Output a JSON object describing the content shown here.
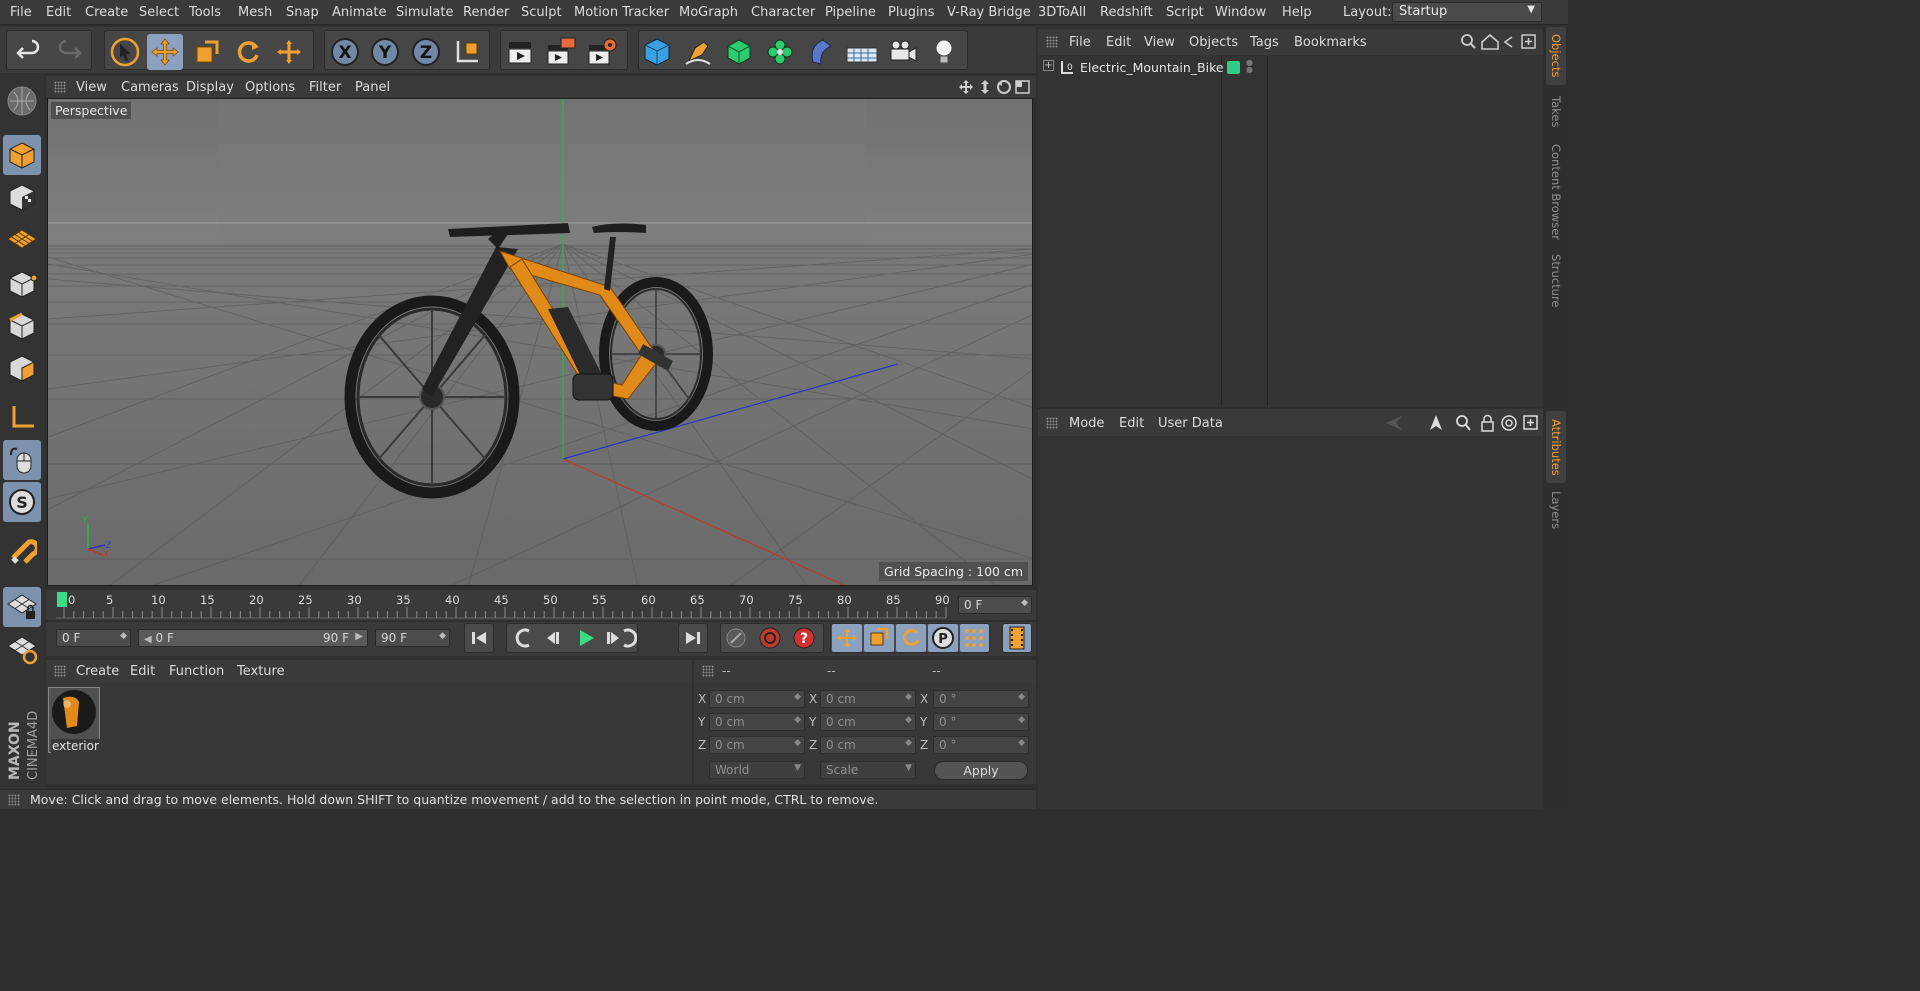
{
  "menubar": {
    "items": [
      "File",
      "Edit",
      "Create",
      "Select",
      "Tools",
      "Mesh",
      "Snap",
      "Animate",
      "Simulate",
      "Render",
      "Sculpt",
      "Motion Tracker",
      "MoGraph",
      "Character",
      "Pipeline",
      "Plugins",
      "V-Ray Bridge",
      "3DToAll",
      "Redshift",
      "Script",
      "Window",
      "Help"
    ],
    "layout_label": "Layout:",
    "layout_value": "Startup"
  },
  "viewport": {
    "menu": [
      "View",
      "Cameras",
      "Display",
      "Options",
      "Filter",
      "Panel"
    ],
    "camera_label": "Perspective",
    "grid_spacing": "Grid Spacing : 100 cm",
    "axis_labels": {
      "y": "Y",
      "x": "X",
      "z": "Z"
    }
  },
  "timeline": {
    "ticks": [
      "0",
      "5",
      "10",
      "15",
      "20",
      "25",
      "30",
      "35",
      "40",
      "45",
      "50",
      "55",
      "60",
      "65",
      "70",
      "75",
      "80",
      "85",
      "90"
    ],
    "current_frame": "0 F",
    "start_field": "0 F",
    "range_start": "0 F",
    "range_end": "90 F",
    "end_field": "90 F"
  },
  "material_manager": {
    "menu": [
      "Create",
      "Edit",
      "Function",
      "Texture"
    ],
    "materials": [
      {
        "name": "exterior"
      }
    ]
  },
  "coordinates": {
    "headers": [
      "--",
      "--",
      "--"
    ],
    "rows": [
      {
        "axis": "X",
        "pos": "0 cm",
        "size": "0 cm",
        "rot_axis": "X",
        "rot": "0 °"
      },
      {
        "axis": "Y",
        "pos": "0 cm",
        "size": "0 cm",
        "rot_axis": "Y",
        "rot": "0 °"
      },
      {
        "axis": "Z",
        "pos": "0 cm",
        "size": "0 cm",
        "rot_axis": "Z",
        "rot": "0 °"
      }
    ],
    "world_select": "World",
    "scale_select": "Scale",
    "apply_label": "Apply"
  },
  "status": {
    "text": "Move: Click and drag to move elements. Hold down SHIFT to quantize movement / add to the selection in point mode, CTRL to remove."
  },
  "logo": {
    "brand": "MAXON",
    "product": "CINEMA4D"
  },
  "objects_panel": {
    "menu": [
      "File",
      "Edit",
      "View",
      "Objects",
      "Tags",
      "Bookmarks"
    ],
    "objects": [
      {
        "name": "Electric_Mountain_Bike",
        "layer_color": "#2ecc8a"
      }
    ]
  },
  "attributes_panel": {
    "menu": [
      "Mode",
      "Edit",
      "User Data"
    ]
  },
  "side_tabs": [
    "Objects",
    "Takes",
    "Content Browser",
    "Structure",
    "Attributes",
    "Layers"
  ],
  "colors": {
    "accent": "#f0a030",
    "active_tool": "#8aa2bf",
    "x_axis": "#c0392b",
    "y_axis": "#27ae60",
    "z_axis": "#2b35c0"
  }
}
